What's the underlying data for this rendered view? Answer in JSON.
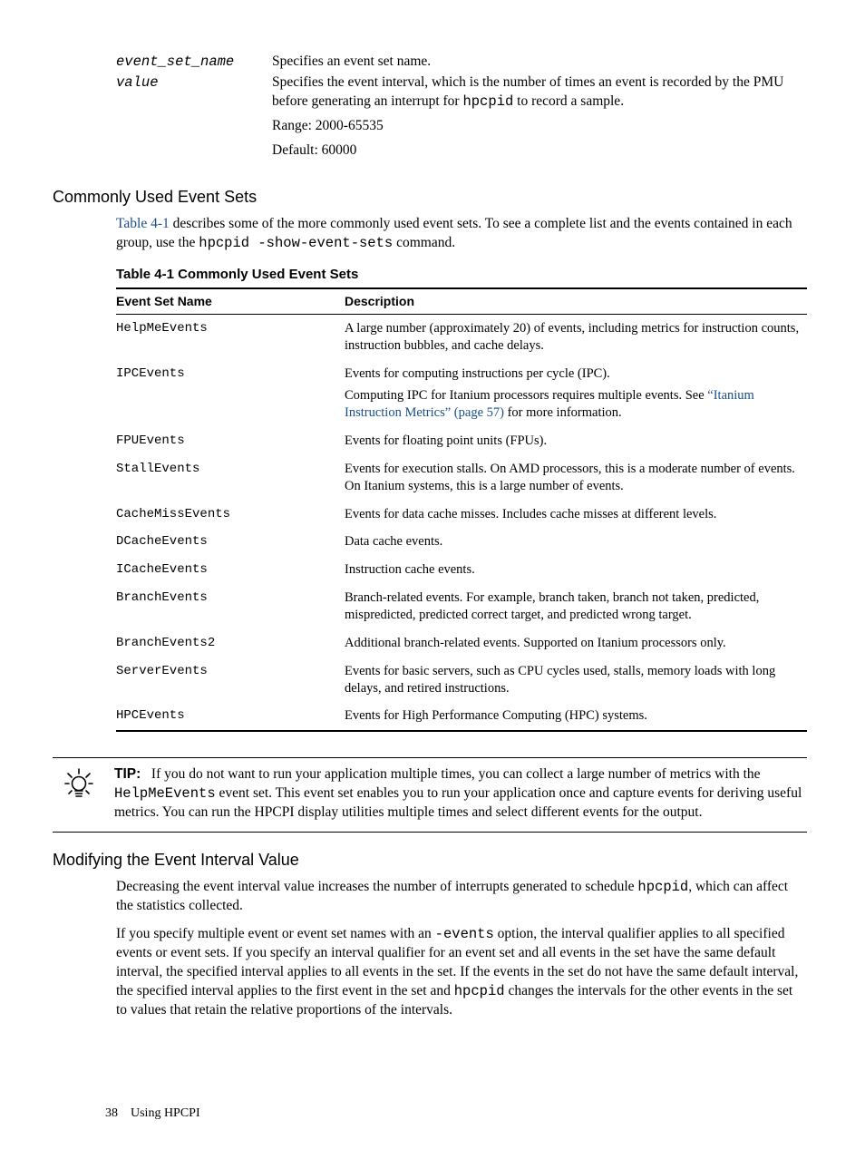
{
  "params": {
    "p1": {
      "term": "event_set_name",
      "desc": "Specifies an event set name."
    },
    "p2": {
      "term": "value",
      "desc_pre": "Specifies the event interval, which is the number of times an event is recorded by the PMU before generating an interrupt for ",
      "desc_code": "hpcpid",
      "desc_post": " to record a sample.",
      "range": "Range: 2000-65535",
      "default": "Default: 60000"
    }
  },
  "sec1": {
    "heading": "Commonly Used Event Sets",
    "intro_link": "Table 4-1",
    "intro_mid": " describes some of the more commonly used event sets. To see a complete list and the events contained in each group, use the ",
    "intro_code": "hpcpid -show-event-sets",
    "intro_end": " command.",
    "caption": "Table  4-1  Commonly Used Event Sets",
    "th1": "Event Set Name",
    "th2": "Description",
    "rows": [
      {
        "name": "HelpMeEvents",
        "desc": "A large number (approximately 20) of events, including metrics for instruction counts, instruction bubbles, and cache delays."
      },
      {
        "name": "IPCEvents",
        "desc": "Events for computing instructions per cycle (IPC).",
        "extra_pre": "Computing IPC for Itanium processors requires multiple events. See ",
        "extra_link": "“Itanium Instruction Metrics” (page 57)",
        "extra_post": " for more information."
      },
      {
        "name": "FPUEvents",
        "desc": "Events for floating point units (FPUs)."
      },
      {
        "name": "StallEvents",
        "desc": "Events for execution stalls. On AMD processors, this is a moderate number of events. On Itanium systems, this is a large number of events."
      },
      {
        "name": "CacheMissEvents",
        "desc": "Events for data cache misses. Includes cache misses at different levels."
      },
      {
        "name": "DCacheEvents",
        "desc": "Data cache events."
      },
      {
        "name": "ICacheEvents",
        "desc": "Instruction cache events."
      },
      {
        "name": "BranchEvents",
        "desc": "Branch-related events. For example, branch taken, branch not taken, predicted, mispredicted, predicted correct target, and predicted wrong target."
      },
      {
        "name": "BranchEvents2",
        "desc": "Additional branch-related events. Supported on Itanium processors only."
      },
      {
        "name": "ServerEvents",
        "desc": "Events for basic servers, such as CPU cycles used, stalls, memory loads with long delays, and retired instructions."
      },
      {
        "name": "HPCEvents",
        "desc": "Events for High Performance Computing (HPC) systems."
      }
    ]
  },
  "tip": {
    "label": "TIP:",
    "t1": "If you do not want to run your application multiple times, you can collect a large number of metrics with the ",
    "code": "HelpMeEvents",
    "t2": " event set. This event set enables you to run your application once and capture events for deriving useful metrics. You can run the HPCPI display utilities multiple times and select different events for the output."
  },
  "sec2": {
    "heading": "Modifying the Event Interval Value",
    "p1a": "Decreasing the event interval value increases the number of interrupts generated to schedule ",
    "p1code": "hpcpid",
    "p1b": ", which can affect the statistics collected.",
    "p2a": "If you specify multiple event or event set names with an ",
    "p2code1": "-events",
    "p2b": " option, the interval qualifier applies to all specified events or event sets. If you specify an interval qualifier for an event set and all events in the set have the same default interval, the specified interval applies to all events in the set. If the events in the set do not have the same default interval, the specified interval applies to the first event in the set and ",
    "p2code2": "hpcpid",
    "p2c": " changes the intervals for the other events in the set to values that retain the relative proportions of the intervals."
  },
  "footer": {
    "page": "38",
    "title": "Using HPCPI"
  }
}
